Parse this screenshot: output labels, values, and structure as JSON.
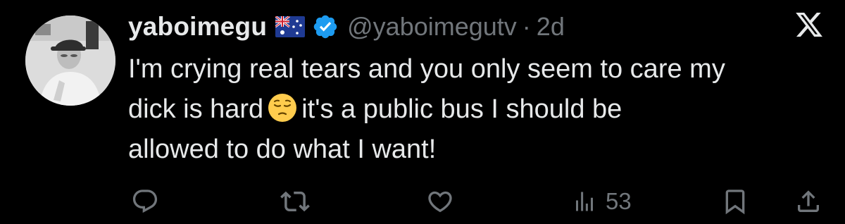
{
  "tweet": {
    "display_name": "yaboimegu",
    "flag_icon": "australia-flag-icon",
    "verified_icon": "verified-badge-icon",
    "handle": "@yaboimegutv",
    "separator": "·",
    "age": "2d",
    "text_lines": [
      "I'm crying real tears and you only seem to care my",
      "dick is hard",
      "it's a public bus I should be",
      "allowed to do what I want!"
    ],
    "emoji": "pensive-face-emoji"
  },
  "actions": {
    "reply_icon": "reply-icon",
    "retweet_icon": "retweet-icon",
    "like_icon": "heart-icon",
    "views_icon": "views-chart-icon",
    "views_count": "53",
    "bookmark_icon": "bookmark-icon",
    "share_icon": "share-icon"
  },
  "colors": {
    "background": "#000000",
    "text": "#e7e9ea",
    "muted": "#71767b",
    "verified_blue": "#1d9bf0"
  }
}
